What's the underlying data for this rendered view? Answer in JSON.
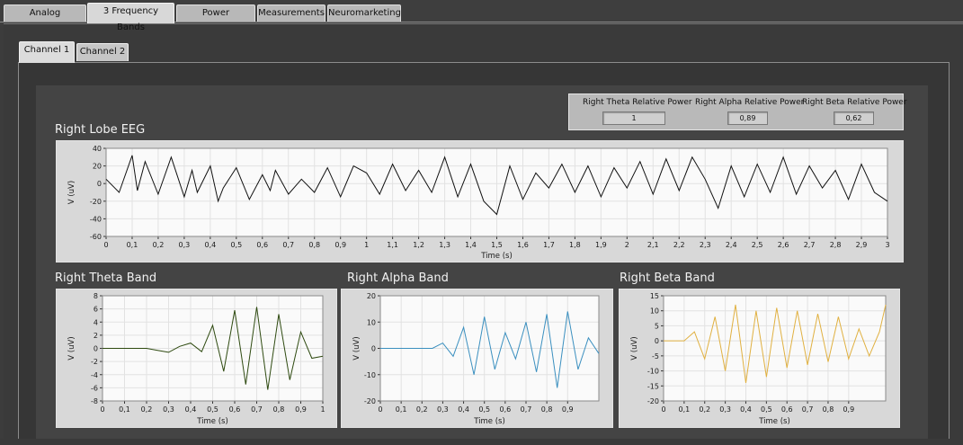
{
  "tabs": [
    {
      "label": "Analog Processing",
      "active": false
    },
    {
      "label": "3 Frequency Bands",
      "active": true
    },
    {
      "label": "Power Spectrums",
      "active": false
    },
    {
      "label": "Measurements",
      "active": false
    },
    {
      "label": "Neuromarketing",
      "active": false
    }
  ],
  "channel_tabs": [
    {
      "label": "Channel 1",
      "active": true
    },
    {
      "label": "Channel 2",
      "active": false
    }
  ],
  "power": {
    "theta_label": "Right Theta Relative Power",
    "theta_value": "1",
    "alpha_label": "Right Alpha Relative Power",
    "alpha_value": "0,89",
    "beta_label": "Right Beta Relative Power",
    "beta_value": "0,62"
  },
  "chart_data": [
    {
      "type": "line",
      "title": "Right Lobe EEG",
      "xlabel": "Time (s)",
      "ylabel": "V (uV)",
      "xlim": [
        0,
        3
      ],
      "ylim": [
        -60,
        40
      ],
      "xticks": [
        "0",
        "0,1",
        "0,2",
        "0,3",
        "0,4",
        "0,5",
        "0,6",
        "0,7",
        "0,8",
        "0,9",
        "1",
        "1,1",
        "1,2",
        "1,3",
        "1,4",
        "1,5",
        "1,6",
        "1,7",
        "1,8",
        "1,9",
        "2",
        "2,1",
        "2,2",
        "2,3",
        "2,4",
        "2,5",
        "2,6",
        "2,7",
        "2,8",
        "2,9",
        "3"
      ],
      "yticks": [
        "40",
        "20",
        "0",
        "-20",
        "-40",
        "-60"
      ],
      "color": "#111111",
      "grid": true,
      "x": [
        0,
        0.05,
        0.1,
        0.12,
        0.15,
        0.2,
        0.25,
        0.3,
        0.33,
        0.35,
        0.4,
        0.43,
        0.45,
        0.5,
        0.55,
        0.6,
        0.63,
        0.65,
        0.7,
        0.75,
        0.8,
        0.85,
        0.9,
        0.95,
        1.0,
        1.05,
        1.1,
        1.15,
        1.2,
        1.25,
        1.3,
        1.35,
        1.4,
        1.45,
        1.5,
        1.55,
        1.6,
        1.65,
        1.7,
        1.75,
        1.8,
        1.85,
        1.9,
        1.95,
        2.0,
        2.05,
        2.1,
        2.15,
        2.2,
        2.25,
        2.3,
        2.35,
        2.4,
        2.45,
        2.5,
        2.55,
        2.6,
        2.65,
        2.7,
        2.75,
        2.8,
        2.85,
        2.9,
        2.95,
        3.0
      ],
      "y": [
        5,
        -10,
        32,
        -8,
        25,
        -12,
        30,
        -15,
        15,
        -10,
        20,
        -20,
        -5,
        18,
        -18,
        10,
        -8,
        15,
        -12,
        5,
        -10,
        18,
        -15,
        20,
        12,
        -12,
        22,
        -8,
        15,
        -10,
        30,
        -15,
        22,
        -20,
        -35,
        20,
        -18,
        12,
        -5,
        22,
        -10,
        20,
        -15,
        18,
        -5,
        25,
        -12,
        28,
        -8,
        30,
        5,
        -28,
        20,
        -15,
        22,
        -10,
        30,
        -12,
        20,
        -5,
        15,
        -18,
        22,
        -10,
        -20
      ]
    },
    {
      "type": "line",
      "title": "Right Theta Band",
      "xlabel": "Time (s)",
      "ylabel": "V (uV)",
      "xlim": [
        0,
        1
      ],
      "ylim": [
        -8,
        8
      ],
      "xticks": [
        "0",
        "0,1",
        "0,2",
        "0,3",
        "0,4",
        "0,5",
        "0,6",
        "0,7",
        "0,8",
        "0,9",
        "1"
      ],
      "yticks": [
        "8",
        "6",
        "4",
        "2",
        "0",
        "-2",
        "-4",
        "-6",
        "-8"
      ],
      "color": "#2e4a10",
      "grid": true,
      "x": [
        0,
        0.2,
        0.25,
        0.3,
        0.35,
        0.4,
        0.45,
        0.5,
        0.55,
        0.6,
        0.65,
        0.7,
        0.75,
        0.8,
        0.85,
        0.9,
        0.95,
        1.0
      ],
      "y": [
        0,
        0,
        -0.3,
        -0.6,
        0.3,
        0.8,
        -0.5,
        3.5,
        -3.5,
        5.8,
        -5.5,
        6.3,
        -6.3,
        5.2,
        -4.8,
        2.5,
        -1.5,
        -1.2
      ]
    },
    {
      "type": "line",
      "title": "Right Alpha Band",
      "xlabel": "Time (s)",
      "ylabel": "V (uV)",
      "xlim": [
        0,
        1.05
      ],
      "ylim": [
        -20,
        20
      ],
      "xticks": [
        "0",
        "0,1",
        "0,2",
        "0,3",
        "0,4",
        "0,5",
        "0,6",
        "0,7",
        "0,8",
        "0,9"
      ],
      "yticks": [
        "20",
        "10",
        "0",
        "-10",
        "-20"
      ],
      "color": "#3a8fbf",
      "grid": true,
      "x": [
        0,
        0.25,
        0.3,
        0.35,
        0.4,
        0.45,
        0.5,
        0.55,
        0.6,
        0.65,
        0.7,
        0.75,
        0.8,
        0.85,
        0.9,
        0.95,
        1.0,
        1.05
      ],
      "y": [
        0,
        0,
        2,
        -3,
        8,
        -10,
        12,
        -8,
        6,
        -4,
        10,
        -9,
        13,
        -15,
        14,
        -8,
        4,
        -2
      ]
    },
    {
      "type": "line",
      "title": "Right Beta Band",
      "xlabel": "Time (s)",
      "ylabel": "V (uV)",
      "xlim": [
        0,
        1.08
      ],
      "ylim": [
        -20,
        15
      ],
      "xticks": [
        "0",
        "0,1",
        "0,2",
        "0,3",
        "0,4",
        "0,5",
        "0,6",
        "0,7",
        "0,8",
        "0,9"
      ],
      "yticks": [
        "15",
        "10",
        "5",
        "0",
        "-5",
        "-10",
        "-15",
        "-20"
      ],
      "color": "#e0b040",
      "grid": true,
      "x": [
        0,
        0.1,
        0.15,
        0.2,
        0.25,
        0.3,
        0.35,
        0.4,
        0.45,
        0.5,
        0.55,
        0.6,
        0.65,
        0.7,
        0.75,
        0.8,
        0.85,
        0.9,
        0.95,
        1.0,
        1.05,
        1.08
      ],
      "y": [
        0,
        0,
        3,
        -6,
        8,
        -10,
        12,
        -14,
        10,
        -12,
        11,
        -9,
        10,
        -8,
        9,
        -7,
        8,
        -6,
        4,
        -5,
        3,
        12
      ]
    }
  ]
}
